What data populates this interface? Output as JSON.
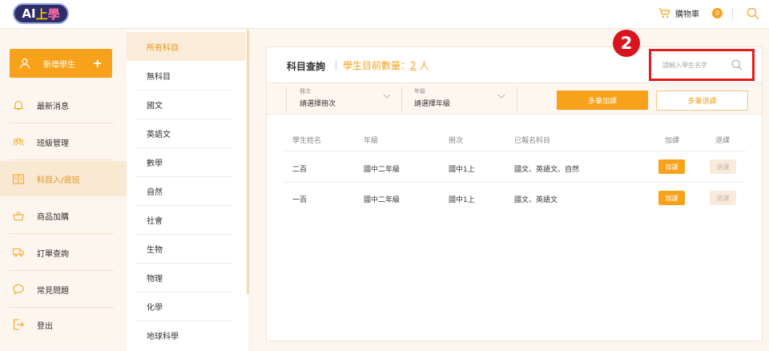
{
  "header": {
    "logo": {
      "a": "AI",
      "b": "上",
      "c": "學"
    },
    "cart_label": "購物車",
    "cart_count": "0",
    "icons": [
      "cart-icon",
      "search-icon"
    ]
  },
  "sidebar": {
    "add_student": "新增學生",
    "add_plus": "+",
    "items": [
      {
        "label": "最新消息",
        "icon": "bell-icon"
      },
      {
        "label": "班級管理",
        "icon": "people-icon"
      },
      {
        "label": "科目入/退班",
        "icon": "book-icon",
        "active": true
      },
      {
        "label": "商品加購",
        "icon": "basket-icon"
      },
      {
        "label": "訂單查詢",
        "icon": "truck-icon"
      },
      {
        "label": "常見問題",
        "icon": "chat-icon"
      },
      {
        "label": "登出",
        "icon": "logout-icon"
      }
    ]
  },
  "subjects": [
    "所有科目",
    "無科目",
    "國文",
    "英語文",
    "數學",
    "自然",
    "社會",
    "生物",
    "物理",
    "化學",
    "地球科學"
  ],
  "main": {
    "title": "科目查詢",
    "count_prefix": "學生目前數量：",
    "count_value": "2",
    "count_suffix": " 人",
    "search_placeholder": "請輸入學生名字",
    "marker": "2",
    "filters": {
      "volume": {
        "caption": "冊次",
        "value": "請選擇冊次"
      },
      "grade": {
        "caption": "年級",
        "value": "請選擇年級"
      }
    },
    "bulk_add": "多筆加課",
    "bulk_drop": "多筆退課",
    "columns": [
      "學生姓名",
      "年級",
      "冊次",
      "已報名科目",
      "加課",
      "退課"
    ],
    "rows": [
      {
        "name": "二百",
        "grade": "國中二年級",
        "volume": "國中1上",
        "subjects": "國文、英語文、自然",
        "add": "加課",
        "drop": "退課"
      },
      {
        "name": "一百",
        "grade": "國中二年級",
        "volume": "國中1上",
        "subjects": "國文、英語文",
        "add": "加課",
        "drop": "退課"
      }
    ]
  },
  "colors": {
    "accent": "#f7a21a",
    "highlight": "#e41c1c",
    "marker": "#d8141e"
  }
}
